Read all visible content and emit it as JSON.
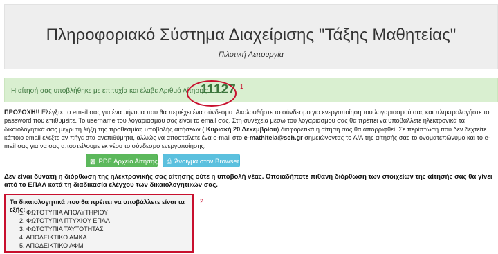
{
  "header": {
    "title": "Πληροφοριακό Σύστημα Διαχείρισης \"Τάξης Μαθητείας\"",
    "subtitle": "Πιλοτική Λειτουργία"
  },
  "alert": {
    "message": "Η αίτησή σας υποβλήθηκε με επιτυχία και έλαβε Αριθμό Αίτησης:",
    "application_number": "11127",
    "marker": "1"
  },
  "notice": {
    "label": "ΠΡΟΣΟΧΗ!!",
    "part1": " Ελέγξτε το email σας για ένα μήνυμα που θα περιέχει ένα σύνδεσμο. Ακολουθήστε το σύνδεσμο για ενεργοποίηση του λογαριασμού σας και πληκτρολογήστε το password που επιθυμείτε. Το username του λογαριασμού σας είναι το email σας. Στη συνέχεια μέσω του λογαριασμού σας θα πρέπει να υποβάλλετε ηλεκτρονικά τα δικαιολογητικά σας μέχρι τη λήξη της προθεσμίας υποβολής αιτήσεων ( ",
    "deadline": "Κυριακή 20 Δεκεμβρίου",
    "part2": ") διαφορετικά η αίτηση σας θα απορριφθεί. Σε περίπτωση που δεν δεχτείτε κάποιο email ελέξτε αν πήγε στα ανεπιθύμητα, αλλιώς να αποστείλετε ένα e-mail στο ",
    "email": "e-mathiteia@sch.gr",
    "part3": " σημειώνοντας το Α/Α της αίτησής σας το ονοματεπώνυμο και το e-mail σας για να σας αποστείλουμε εκ νέου το σύνδεσμο ενεργοποίησης."
  },
  "buttons": {
    "pdf": "PDF Αρχείο Αίτησης",
    "browser": "Άνοιγμα στον Browser"
  },
  "warning": "Δεν είναι δυνατή η διόρθωση της ηλεκτρονικής σας αίτησης ούτε η υποβολή νέας. Οποιαδήποτε πιθανή διόρθωση των στοιχείων της αίτησής σας θα γίνει από το ΕΠΑΛ κατά τη διαδικασία ελέγχου των δικαιολογητικών σας.",
  "documents": {
    "heading": "Τα δικαιολογητικά που θα πρέπει να υποβάλλετε είναι τα εξής:",
    "marker": "2",
    "items": [
      "1. ΦΩΤΟΤΥΠΙΑ ΑΠΟΛΥΤΗΡΙΟΥ",
      "2. ΦΩΤΟΤΥΠΙΑ ΠΤΥΧΙΟΥ ΕΠΑΛ",
      "3. ΦΩΤΟΤΥΠΙΑ ΤΑΥΤΟΤΗΤΑΣ",
      "4. ΑΠΟΔΕΙΚΤΙΚΟ ΑΜΚΑ",
      "5. ΑΠΟΔΕΙΚΤΙΚΟ ΑΦΜ"
    ]
  },
  "colors": {
    "header_bg": "#eeeeee",
    "alert_bg": "#d9efd0",
    "alert_text": "#3c763d",
    "highlight_red": "#c8102e",
    "pdf_button": "#5cb85c",
    "browser_button": "#5bc0de"
  },
  "icons": {
    "pdf": "file-pdf-icon",
    "browser": "printer-icon"
  }
}
